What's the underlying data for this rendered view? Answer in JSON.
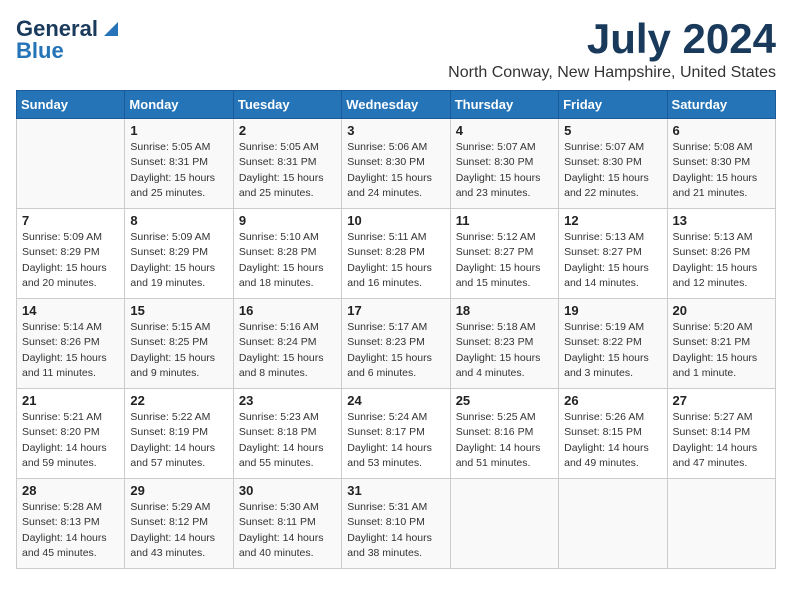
{
  "header": {
    "logo_line1": "General",
    "logo_line2": "Blue",
    "month": "July 2024",
    "location": "North Conway, New Hampshire, United States"
  },
  "weekdays": [
    "Sunday",
    "Monday",
    "Tuesday",
    "Wednesday",
    "Thursday",
    "Friday",
    "Saturday"
  ],
  "weeks": [
    [
      {
        "day": "",
        "info": ""
      },
      {
        "day": "1",
        "info": "Sunrise: 5:05 AM\nSunset: 8:31 PM\nDaylight: 15 hours\nand 25 minutes."
      },
      {
        "day": "2",
        "info": "Sunrise: 5:05 AM\nSunset: 8:31 PM\nDaylight: 15 hours\nand 25 minutes."
      },
      {
        "day": "3",
        "info": "Sunrise: 5:06 AM\nSunset: 8:30 PM\nDaylight: 15 hours\nand 24 minutes."
      },
      {
        "day": "4",
        "info": "Sunrise: 5:07 AM\nSunset: 8:30 PM\nDaylight: 15 hours\nand 23 minutes."
      },
      {
        "day": "5",
        "info": "Sunrise: 5:07 AM\nSunset: 8:30 PM\nDaylight: 15 hours\nand 22 minutes."
      },
      {
        "day": "6",
        "info": "Sunrise: 5:08 AM\nSunset: 8:30 PM\nDaylight: 15 hours\nand 21 minutes."
      }
    ],
    [
      {
        "day": "7",
        "info": "Sunrise: 5:09 AM\nSunset: 8:29 PM\nDaylight: 15 hours\nand 20 minutes."
      },
      {
        "day": "8",
        "info": "Sunrise: 5:09 AM\nSunset: 8:29 PM\nDaylight: 15 hours\nand 19 minutes."
      },
      {
        "day": "9",
        "info": "Sunrise: 5:10 AM\nSunset: 8:28 PM\nDaylight: 15 hours\nand 18 minutes."
      },
      {
        "day": "10",
        "info": "Sunrise: 5:11 AM\nSunset: 8:28 PM\nDaylight: 15 hours\nand 16 minutes."
      },
      {
        "day": "11",
        "info": "Sunrise: 5:12 AM\nSunset: 8:27 PM\nDaylight: 15 hours\nand 15 minutes."
      },
      {
        "day": "12",
        "info": "Sunrise: 5:13 AM\nSunset: 8:27 PM\nDaylight: 15 hours\nand 14 minutes."
      },
      {
        "day": "13",
        "info": "Sunrise: 5:13 AM\nSunset: 8:26 PM\nDaylight: 15 hours\nand 12 minutes."
      }
    ],
    [
      {
        "day": "14",
        "info": "Sunrise: 5:14 AM\nSunset: 8:26 PM\nDaylight: 15 hours\nand 11 minutes."
      },
      {
        "day": "15",
        "info": "Sunrise: 5:15 AM\nSunset: 8:25 PM\nDaylight: 15 hours\nand 9 minutes."
      },
      {
        "day": "16",
        "info": "Sunrise: 5:16 AM\nSunset: 8:24 PM\nDaylight: 15 hours\nand 8 minutes."
      },
      {
        "day": "17",
        "info": "Sunrise: 5:17 AM\nSunset: 8:23 PM\nDaylight: 15 hours\nand 6 minutes."
      },
      {
        "day": "18",
        "info": "Sunrise: 5:18 AM\nSunset: 8:23 PM\nDaylight: 15 hours\nand 4 minutes."
      },
      {
        "day": "19",
        "info": "Sunrise: 5:19 AM\nSunset: 8:22 PM\nDaylight: 15 hours\nand 3 minutes."
      },
      {
        "day": "20",
        "info": "Sunrise: 5:20 AM\nSunset: 8:21 PM\nDaylight: 15 hours\nand 1 minute."
      }
    ],
    [
      {
        "day": "21",
        "info": "Sunrise: 5:21 AM\nSunset: 8:20 PM\nDaylight: 14 hours\nand 59 minutes."
      },
      {
        "day": "22",
        "info": "Sunrise: 5:22 AM\nSunset: 8:19 PM\nDaylight: 14 hours\nand 57 minutes."
      },
      {
        "day": "23",
        "info": "Sunrise: 5:23 AM\nSunset: 8:18 PM\nDaylight: 14 hours\nand 55 minutes."
      },
      {
        "day": "24",
        "info": "Sunrise: 5:24 AM\nSunset: 8:17 PM\nDaylight: 14 hours\nand 53 minutes."
      },
      {
        "day": "25",
        "info": "Sunrise: 5:25 AM\nSunset: 8:16 PM\nDaylight: 14 hours\nand 51 minutes."
      },
      {
        "day": "26",
        "info": "Sunrise: 5:26 AM\nSunset: 8:15 PM\nDaylight: 14 hours\nand 49 minutes."
      },
      {
        "day": "27",
        "info": "Sunrise: 5:27 AM\nSunset: 8:14 PM\nDaylight: 14 hours\nand 47 minutes."
      }
    ],
    [
      {
        "day": "28",
        "info": "Sunrise: 5:28 AM\nSunset: 8:13 PM\nDaylight: 14 hours\nand 45 minutes."
      },
      {
        "day": "29",
        "info": "Sunrise: 5:29 AM\nSunset: 8:12 PM\nDaylight: 14 hours\nand 43 minutes."
      },
      {
        "day": "30",
        "info": "Sunrise: 5:30 AM\nSunset: 8:11 PM\nDaylight: 14 hours\nand 40 minutes."
      },
      {
        "day": "31",
        "info": "Sunrise: 5:31 AM\nSunset: 8:10 PM\nDaylight: 14 hours\nand 38 minutes."
      },
      {
        "day": "",
        "info": ""
      },
      {
        "day": "",
        "info": ""
      },
      {
        "day": "",
        "info": ""
      }
    ]
  ]
}
